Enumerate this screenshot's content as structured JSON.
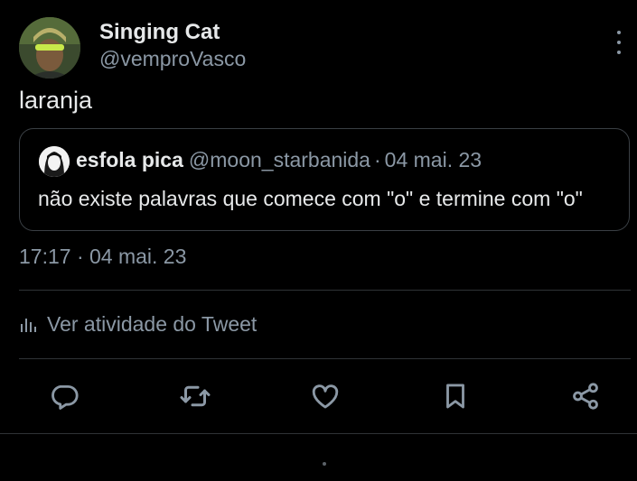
{
  "tweet": {
    "author": {
      "display_name": "Singing Cat",
      "handle": "@vemproVasco",
      "avatar_icon": "profile-avatar"
    },
    "text": "laranja",
    "quoted_tweet": {
      "display_name": "esfola pica",
      "handle": "@moon_starbanida",
      "separator": "·",
      "date": "04 mai. 23",
      "text": "não existe palavras que comece com \"o\" e termine com \"o\""
    },
    "timestamp": "17:17 · 04 mai. 23",
    "activity_label": "Ver atividade do Tweet"
  },
  "actions": [
    {
      "name": "reply",
      "icon": "reply-icon"
    },
    {
      "name": "retweet",
      "icon": "retweet-icon"
    },
    {
      "name": "like",
      "icon": "heart-icon"
    },
    {
      "name": "bookmark",
      "icon": "bookmark-icon"
    },
    {
      "name": "share",
      "icon": "share-icon"
    }
  ],
  "colors": {
    "background": "#000000",
    "primary_text": "#e7e9ea",
    "secondary_text": "#8b98a5",
    "border": "#2f3336"
  }
}
